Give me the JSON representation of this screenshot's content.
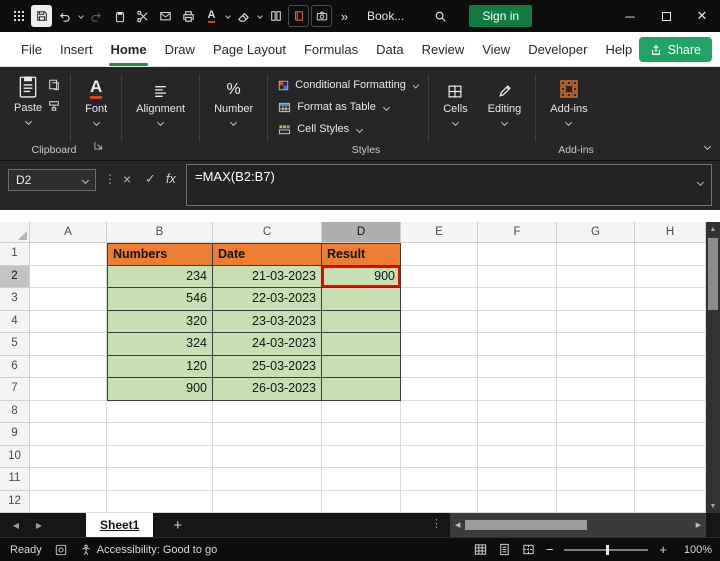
{
  "titlebar": {
    "title": "Book...",
    "signin_label": "Sign in"
  },
  "menubar": {
    "tabs": [
      "File",
      "Insert",
      "Home",
      "Draw",
      "Page Layout",
      "Formulas",
      "Data",
      "Review",
      "View",
      "Developer",
      "Help"
    ],
    "active_tab": "Home",
    "share_label": "Share"
  },
  "ribbon": {
    "paste_label": "Paste",
    "font_label": "Font",
    "alignment_label": "Alignment",
    "number_label": "Number",
    "styles_items": [
      "Conditional Formatting",
      "Format as Table",
      "Cell Styles"
    ],
    "cells_label": "Cells",
    "editing_label": "Editing",
    "addins_label": "Add-ins",
    "footer_clipboard": "Clipboard",
    "footer_styles": "Styles",
    "footer_addins": "Add-ins"
  },
  "formula_bar": {
    "name_box": "D2",
    "fx_label": "fx",
    "formula": "=MAX(B2:B7)"
  },
  "sheet": {
    "col_headers": [
      "A",
      "B",
      "C",
      "D",
      "E",
      "F",
      "G",
      "H"
    ],
    "row_count": 12,
    "selected_cell": "D2",
    "selected_col": "D",
    "selected_row": 2,
    "table_range": {
      "cols": [
        "B",
        "C",
        "D"
      ],
      "header_row": 1,
      "last_data_row": 7
    },
    "cells": {
      "B1": "Numbers",
      "C1": "Date",
      "D1": "Result",
      "B2": "234",
      "C2": "21-03-2023",
      "D2": "900",
      "B3": "546",
      "C3": "22-03-2023",
      "B4": "320",
      "C4": "23-03-2023",
      "B5": "324",
      "C5": "24-03-2023",
      "B6": "120",
      "C6": "25-03-2023",
      "B7": "900",
      "C7": "26-03-2023"
    },
    "colors": {
      "header_fill": "#ED7D31",
      "data_fill": "#C6E0B4",
      "annotation": "#FF0000",
      "accent_green": "#1E8A4E"
    }
  },
  "sheet_tabs": {
    "active": "Sheet1"
  },
  "statusbar": {
    "ready_label": "Ready",
    "accessibility_label": "Accessibility: Good to go",
    "zoom_label": "100%"
  }
}
